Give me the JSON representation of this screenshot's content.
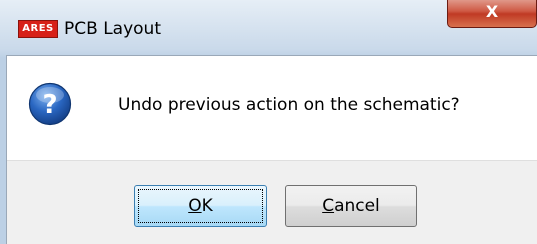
{
  "window": {
    "title": "PCB Layout",
    "app_logo_text": "ARES",
    "close_glyph": "X"
  },
  "dialog": {
    "icon": "question-icon",
    "message": "Undo previous action on the schematic?"
  },
  "buttons": {
    "ok": {
      "mnemonic": "O",
      "rest": "K"
    },
    "cancel": {
      "mnemonic": "C",
      "rest": "ancel"
    }
  },
  "colors": {
    "logo_red": "#d72018",
    "close_red": "#c03a24",
    "icon_blue": "#1f5fb8",
    "ok_focus_border": "#3c7fb1"
  }
}
